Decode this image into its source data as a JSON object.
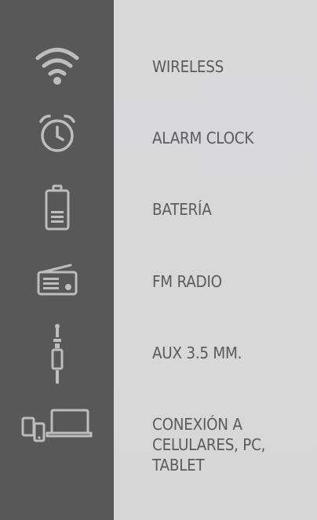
{
  "features": [
    {
      "icon": "wifi-icon",
      "label": "WIRELESS"
    },
    {
      "icon": "alarm-clock-icon",
      "label": "ALARM CLOCK"
    },
    {
      "icon": "battery-icon",
      "label": "BATERÍA"
    },
    {
      "icon": "radio-icon",
      "label": "FM RADIO"
    },
    {
      "icon": "aux-jack-icon",
      "label": "AUX 3.5 MM."
    },
    {
      "icon": "devices-icon",
      "label": "CONEXIÓN A\nCELULARES, PC,\nTABLET"
    }
  ],
  "colors": {
    "sidebar": "#585859",
    "panel": "#d9d9da",
    "icon_stroke": "#bdbdbe",
    "text": "#5b5b5c"
  }
}
